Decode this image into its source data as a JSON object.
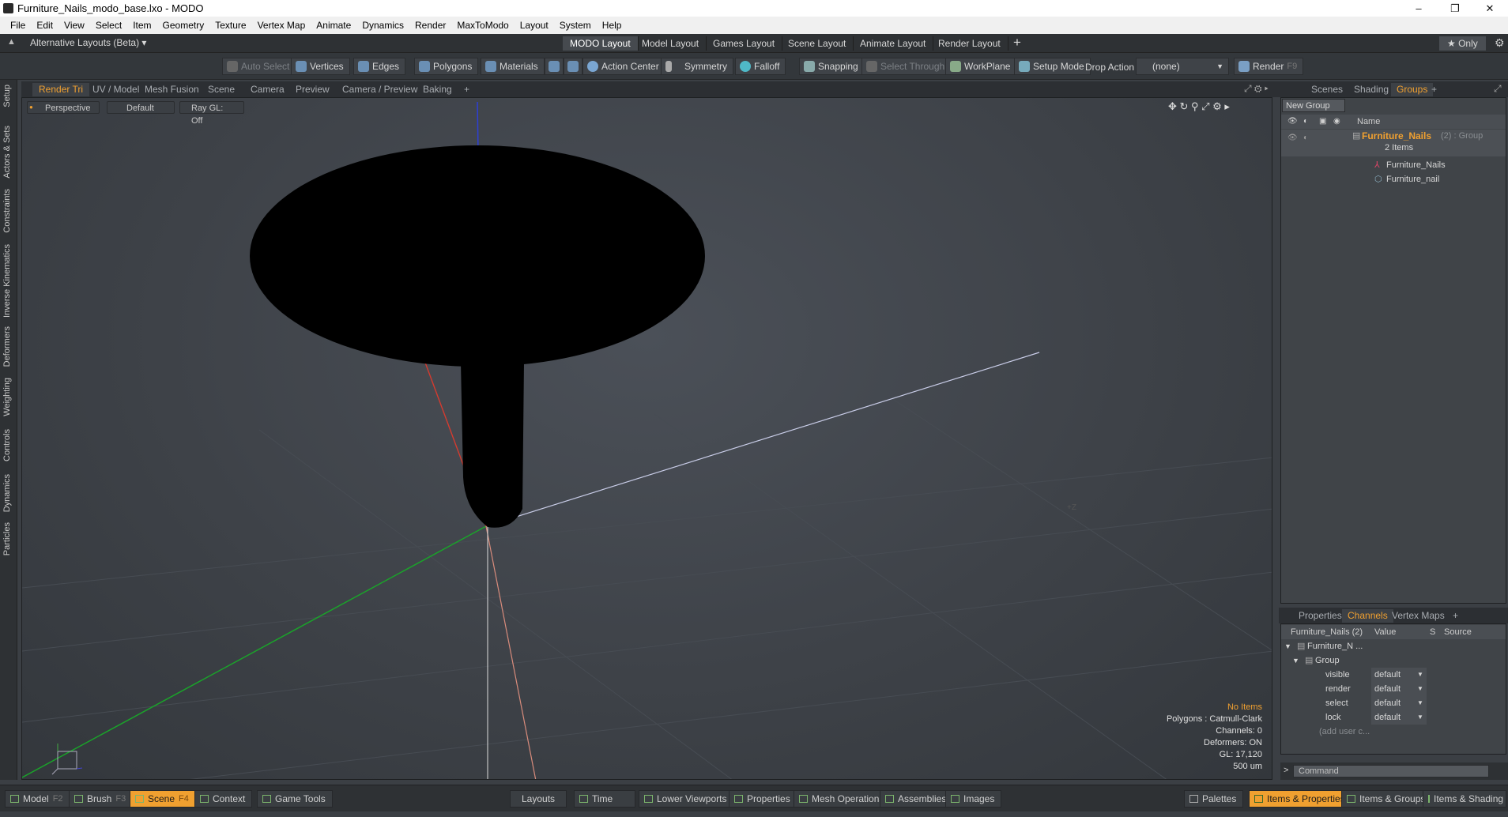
{
  "window": {
    "title": "Furniture_Nails_modo_base.lxo - MODO",
    "controls": [
      "–",
      "❐",
      "✕"
    ]
  },
  "menu": [
    "File",
    "Edit",
    "View",
    "Select",
    "Item",
    "Geometry",
    "Texture",
    "Vertex Map",
    "Animate",
    "Dynamics",
    "Render",
    "MaxToModo",
    "Layout",
    "System",
    "Help"
  ],
  "layouts": {
    "selector": "Alternative Layouts (Beta) ▾",
    "tabs": [
      "MODO Layout",
      "Model Layout",
      "Games Layout",
      "Scene Layout",
      "Animate Layout",
      "Render Layout"
    ],
    "active": "MODO Layout",
    "add": "+",
    "only": "★ Only"
  },
  "toolbar": {
    "auto_select": "Auto Select",
    "vertices": "Vertices",
    "edges": "Edges",
    "polygons": "Polygons",
    "materials": "Materials",
    "action_center": "Action Center",
    "symmetry": "Symmetry",
    "falloff": "Falloff",
    "snapping": "Snapping",
    "select_through": "Select Through",
    "workplane": "WorkPlane",
    "setup_mode": "Setup Mode",
    "drop_action_label": "Drop Action",
    "drop_action_value": "(none)",
    "render": "Render",
    "render_key": "F9"
  },
  "left_tabs": [
    "Setup",
    "Actors & Sets",
    "Constraints",
    "Inverse Kinematics",
    "Deformers",
    "Weighting",
    "Controls",
    "Dynamics",
    "Particles"
  ],
  "viewport": {
    "tabs": [
      "Render Tri",
      "UV / Model",
      "Mesh Fusion",
      "Scene",
      "Camera",
      "Preview",
      "Camera / Preview",
      "Baking",
      "+"
    ],
    "active_tab": "Render Tri",
    "view_mode": "Perspective",
    "shading": "Default",
    "raygl": "Ray GL: Off",
    "info": {
      "items": "No Items",
      "polygons": "Polygons : Catmull-Clark",
      "channels": "Channels: 0",
      "deformers": "Deformers: ON",
      "gl": "GL: 17,120",
      "scale": "500 um"
    },
    "stray_label": "+Z"
  },
  "right_panel": {
    "tabs": [
      "Scenes",
      "Shading",
      "Groups",
      "+"
    ],
    "active_tab": "Groups",
    "new_group": "New Group",
    "name_header": "Name",
    "group": {
      "name": "Furniture_Nails",
      "suffix": "(2) : Group",
      "count": "2 Items",
      "children": [
        "Furniture_Nails",
        "Furniture_nail"
      ]
    }
  },
  "channels_panel": {
    "tabs": [
      "Properties",
      "Channels",
      "Vertex Maps",
      "+"
    ],
    "active_tab": "Channels",
    "headers": {
      "name": "Furniture_Nails (2)",
      "value": "Value",
      "s": "S",
      "source": "Source"
    },
    "root": "Furniture_N ...",
    "group": "Group",
    "rows": [
      {
        "name": "visible",
        "value": "default"
      },
      {
        "name": "render",
        "value": "default"
      },
      {
        "name": "select",
        "value": "default"
      },
      {
        "name": "lock",
        "value": "default"
      }
    ],
    "add_user": "(add user c..."
  },
  "command": {
    "prompt": ">",
    "placeholder": "Command"
  },
  "bottom": {
    "left": [
      {
        "label": "Model",
        "key": "F2"
      },
      {
        "label": "Brush",
        "key": "F3"
      },
      {
        "label": "Scene",
        "key": "F4"
      },
      {
        "label": "Context",
        "key": ""
      },
      {
        "label": "Game Tools",
        "key": ""
      }
    ],
    "active": "Scene",
    "center": [
      "Layouts",
      "Time",
      "Lower Viewports",
      "Properties",
      "Mesh Operations",
      "Assemblies",
      "Images"
    ],
    "right": [
      "Palettes",
      "Items & Properties",
      "Items & Groups",
      "Items & Shading"
    ],
    "right_active": "Items & Properties"
  }
}
